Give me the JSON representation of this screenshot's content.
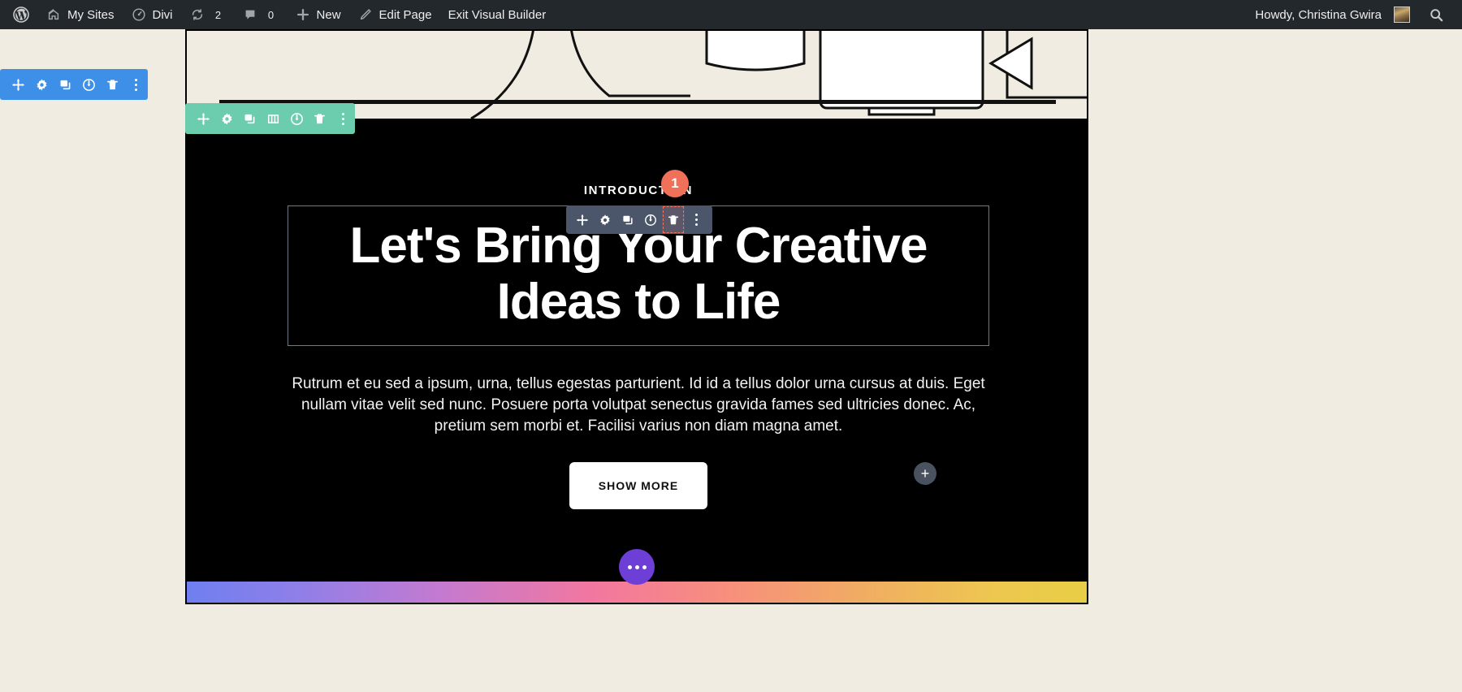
{
  "adminbar": {
    "logo_icon": "wordpress-logo-icon",
    "items": [
      {
        "label": "My Sites",
        "icon": "sites-icon"
      },
      {
        "label": "Divi",
        "icon": "divi-dashboard-icon"
      },
      {
        "label": "2",
        "icon": "updates-icon"
      },
      {
        "label": "0",
        "icon": "comments-icon"
      },
      {
        "label": "New",
        "icon": "plus-icon"
      },
      {
        "label": "Edit Page",
        "icon": "pencil-icon"
      },
      {
        "label": "Exit Visual Builder",
        "icon": ""
      }
    ],
    "howdy": "Howdy, Christina Gwira",
    "avatar_icon": "user-avatar",
    "search_icon": "search-icon"
  },
  "toolbars": {
    "section": {
      "color": "#3e8fe8",
      "buttons": [
        {
          "name": "move-handle",
          "icon": "move-icon"
        },
        {
          "name": "settings",
          "icon": "gear-icon"
        },
        {
          "name": "duplicate",
          "icon": "duplicate-icon"
        },
        {
          "name": "disable",
          "icon": "power-icon"
        },
        {
          "name": "delete",
          "icon": "trash-icon"
        },
        {
          "name": "more-options",
          "icon": "vertical-dots-icon"
        }
      ]
    },
    "row": {
      "color": "#6bcdad",
      "buttons": [
        {
          "name": "move-handle",
          "icon": "move-icon"
        },
        {
          "name": "settings",
          "icon": "gear-icon"
        },
        {
          "name": "duplicate",
          "icon": "duplicate-icon"
        },
        {
          "name": "columns",
          "icon": "columns-icon"
        },
        {
          "name": "disable",
          "icon": "power-icon"
        },
        {
          "name": "delete",
          "icon": "trash-icon"
        },
        {
          "name": "more-options",
          "icon": "vertical-dots-icon"
        }
      ]
    },
    "module": {
      "color": "#4c566b",
      "buttons": [
        {
          "name": "move-handle",
          "icon": "move-icon"
        },
        {
          "name": "settings",
          "icon": "gear-icon"
        },
        {
          "name": "duplicate",
          "icon": "duplicate-icon"
        },
        {
          "name": "disable",
          "icon": "power-icon"
        },
        {
          "name": "delete",
          "icon": "trash-icon"
        },
        {
          "name": "more-options",
          "icon": "vertical-dots-icon"
        }
      ],
      "highlighted_button": "delete"
    }
  },
  "badge": {
    "number": "1",
    "color": "#f0705a"
  },
  "hero": {
    "eyebrow": "INTRODUCTION",
    "headline": "Let's Bring Your Creative Ideas to Life",
    "body": "Rutrum et eu sed a ipsum, urna, tellus egestas parturient. Id id a tellus dolor urna cursus at duis. Eget nullam vitae velit sed nunc. Posuere porta volutpat senectus gravida fames sed ultricies donec. Ac, pretium sem morbi et. Facilisi varius non diam magna amet.",
    "cta_label": "SHOW MORE",
    "background": "#000000",
    "text_color": "#ffffff"
  },
  "gradient_bar": {
    "name": "gradient-divider",
    "stops": [
      "#6f7ff0",
      "#c47ad0",
      "#f2779f",
      "#f0ad62",
      "#e8ce45"
    ]
  },
  "add_buttons": {
    "add_row_label": "+",
    "add_module_label": "+"
  },
  "page_settings": {
    "icon": "ellipsis-icon",
    "color": "#6d3fd6"
  }
}
